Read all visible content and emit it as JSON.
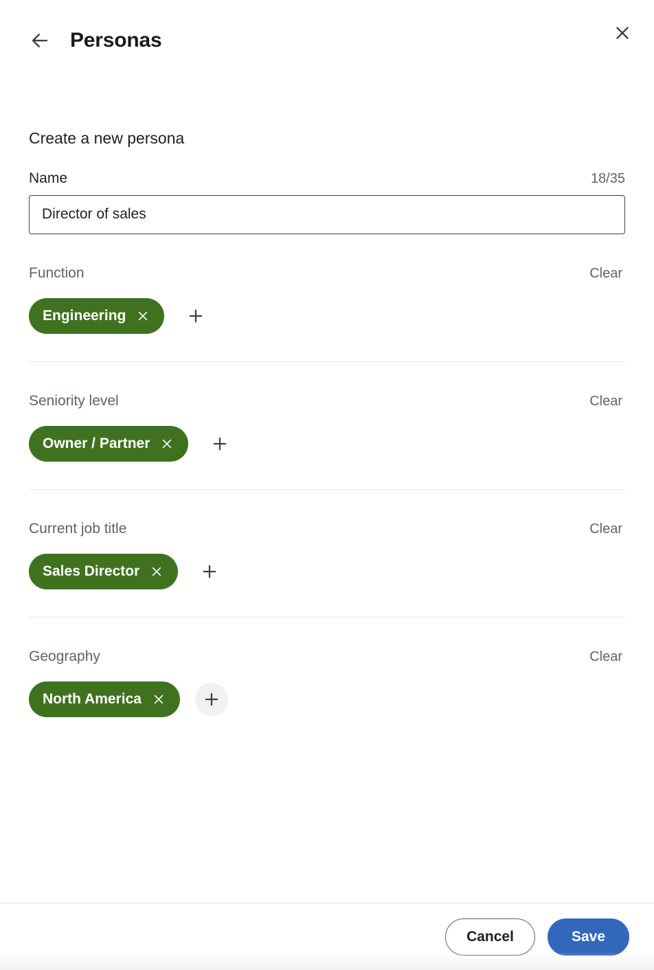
{
  "header": {
    "title": "Personas",
    "back_icon": "arrow-left-icon",
    "close_icon": "close-icon"
  },
  "main": {
    "intro_title": "Create a new persona",
    "name_field": {
      "label": "Name",
      "value": "Director of sales",
      "placeholder": "",
      "counter": "18/35",
      "max_length": 35
    },
    "clear_label": "Clear",
    "add_icon": "plus-icon",
    "remove_icon": "close-icon",
    "facets": [
      {
        "label": "Function",
        "clear_label": "Clear",
        "chips": [
          {
            "label": "Engineering"
          }
        ],
        "add_hovered": false
      },
      {
        "label": "Seniority level",
        "clear_label": "Clear",
        "chips": [
          {
            "label": "Owner / Partner"
          }
        ],
        "add_hovered": false
      },
      {
        "label": "Current job title",
        "clear_label": "Clear",
        "chips": [
          {
            "label": "Sales Director"
          }
        ],
        "add_hovered": false
      },
      {
        "label": "Geography",
        "clear_label": "Clear",
        "chips": [
          {
            "label": "North America"
          }
        ],
        "add_hovered": true
      }
    ]
  },
  "footer": {
    "cancel_label": "Cancel",
    "save_label": "Save"
  },
  "colors": {
    "chip_green": "#40711f",
    "save_blue": "#3367bb",
    "text_primary": "#202124",
    "text_secondary": "#5f6368",
    "divider": "#e4e4e4",
    "add_hover_bg": "#f1f1f1"
  }
}
